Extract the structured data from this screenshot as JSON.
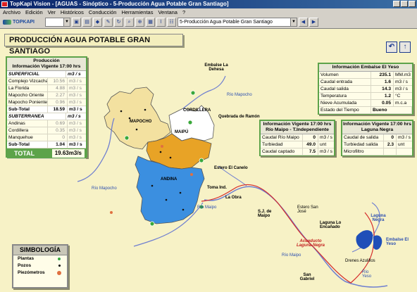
{
  "window": {
    "title": "TopKapi Vision - [AGUAS - Sinóptico - 5-Producción Agua Potable Gran Santiago]"
  },
  "menu": [
    "Archivo",
    "Edición",
    "Ver",
    "Históricos",
    "Conducción",
    "Herramientas",
    "Ventana",
    "?"
  ],
  "toolbar": {
    "brand": "TOPKAPI",
    "view_select": "5-Producción Agua Potable Gran Santiago"
  },
  "page_title": "PRODUCCIÓN AGUA POTABLE GRAN SANTIAGO",
  "nav": {
    "back_icon": "↶",
    "up_icon": "↑"
  },
  "production_panel": {
    "title": "Producción",
    "subtitle": "Información Vigente 17:00 hrs",
    "superficial_label": "SUPERFICIAL",
    "superficial_unit": "m3 / s",
    "superficial": [
      {
        "label": "Complejo Vizcachas",
        "value": "10.56",
        "unit": "m3 / s"
      },
      {
        "label": "La Florida",
        "value": "4.88",
        "unit": "m3 / s"
      },
      {
        "label": "Mapocho Oriente",
        "value": "2.27",
        "unit": "m3 / s"
      },
      {
        "label": "Mapocho Poniente",
        "value": "0.96",
        "unit": "m3 / s"
      }
    ],
    "sub_total_1": {
      "label": "Sub-Total",
      "value": "18.59",
      "unit": "m3 / s"
    },
    "subterranea_label": "SUBTERRANEA",
    "subterranea_unit": "m3 / s",
    "subterranea": [
      {
        "label": "Andinas",
        "value": "0.69",
        "unit": "m3 / s"
      },
      {
        "label": "Cordillera",
        "value": "0.35",
        "unit": "m3 / s"
      },
      {
        "label": "Manquehue",
        "value": "0",
        "unit": "m3 / s"
      }
    ],
    "sub_total_2": {
      "label": "Sub-Total",
      "value": "1.04",
      "unit": "m3 / s"
    },
    "total": {
      "label": "TOTAL",
      "value": "19.63m3/s"
    }
  },
  "yeso_panel": {
    "title": "Información Embalse El Yeso",
    "rows": [
      {
        "label": "Volumen",
        "value": "235.1",
        "unit": "MM.m3"
      },
      {
        "label": "Caudal entrada",
        "value": "1.6",
        "unit": "m3 / s"
      },
      {
        "label": "Caudal salida",
        "value": "14.3",
        "unit": "m3 / s"
      },
      {
        "label": "Temperatura",
        "value": "1.2",
        "unit": "°C"
      },
      {
        "label": "Nieve Acumulada",
        "value": "0.05",
        "unit": "m.c.a"
      },
      {
        "label": "Estado del Tiempo",
        "value": "Bueno",
        "unit": ""
      }
    ]
  },
  "maipo_panel": {
    "title": "Información Vigente 17:00 hrs",
    "subtitle": "Río Maipo - T.Independiente",
    "rows": [
      {
        "label": "Caudal Río Maipo",
        "value": "0",
        "unit": "m3 / s"
      },
      {
        "label": "Turbiedad",
        "value": "49.0",
        "unit": "unt"
      },
      {
        "label": "Caudal captado",
        "value": "7.5",
        "unit": "m3 / s"
      }
    ]
  },
  "laguna_panel": {
    "title": "Información Vigente 17:00 hrs",
    "subtitle": "Laguna Negra",
    "rows": [
      {
        "label": "Caudal de salida",
        "value": "0",
        "unit": "m3 / s"
      },
      {
        "label": "Turbiedad salida",
        "value": "2.3",
        "unit": "unt"
      },
      {
        "label": "Microfiltro",
        "value": "",
        "unit": ""
      }
    ]
  },
  "map": {
    "zones": [
      "MAPOCHO",
      "MAIPÚ",
      "CORDILLERA",
      "ANDINA"
    ],
    "labels": {
      "embalse_la_dehesa": "Embalse La Dehesa",
      "rio_mapocho_1": "Río Mapocho",
      "rio_mapocho_2": "Río Mapocho",
      "quebrada_ramon": "Quebrada de Ramón",
      "estero_canelo": "Estero El Canelo",
      "toma_ind": "Toma Ind.",
      "la_obra": "La Obra",
      "rio_maipo_1": "Río Maipo",
      "rio_maipo_2": "Río Maipo",
      "sj_maipo": "S.J. de Maipo",
      "estero_san_jose": "Estero San José",
      "laguna_encanado": "Laguna Lo Encañado",
      "laguna_negra": "Laguna Negra",
      "embalse_yeso": "Embalse El Yeso",
      "acueducto": "Acueducto Laguna Negra",
      "drenes": "Drenes Azulillos",
      "rio_yeso": "Río Yeso",
      "san_gabriel": "San Gabriel"
    },
    "colors": {
      "mapocho_zone": "#f3e1a0",
      "maipu_zone": "#e8a326",
      "andina_zone": "#3b8fe0",
      "cordillera_zone": "#ffffff",
      "river": "#6f7fd0",
      "aqueduct": "#d52a2a",
      "lake": "#1f4fb8",
      "planta": "#3aa83a",
      "piezometro": "#e07040"
    }
  },
  "legend": {
    "title": "SIMBOLOGÍA",
    "items": [
      {
        "label": "Plantas",
        "color": "#3aa83a"
      },
      {
        "label": "Pozos",
        "color": "#000000"
      },
      {
        "label": "Piezómetros",
        "color": "#e07040"
      }
    ]
  }
}
